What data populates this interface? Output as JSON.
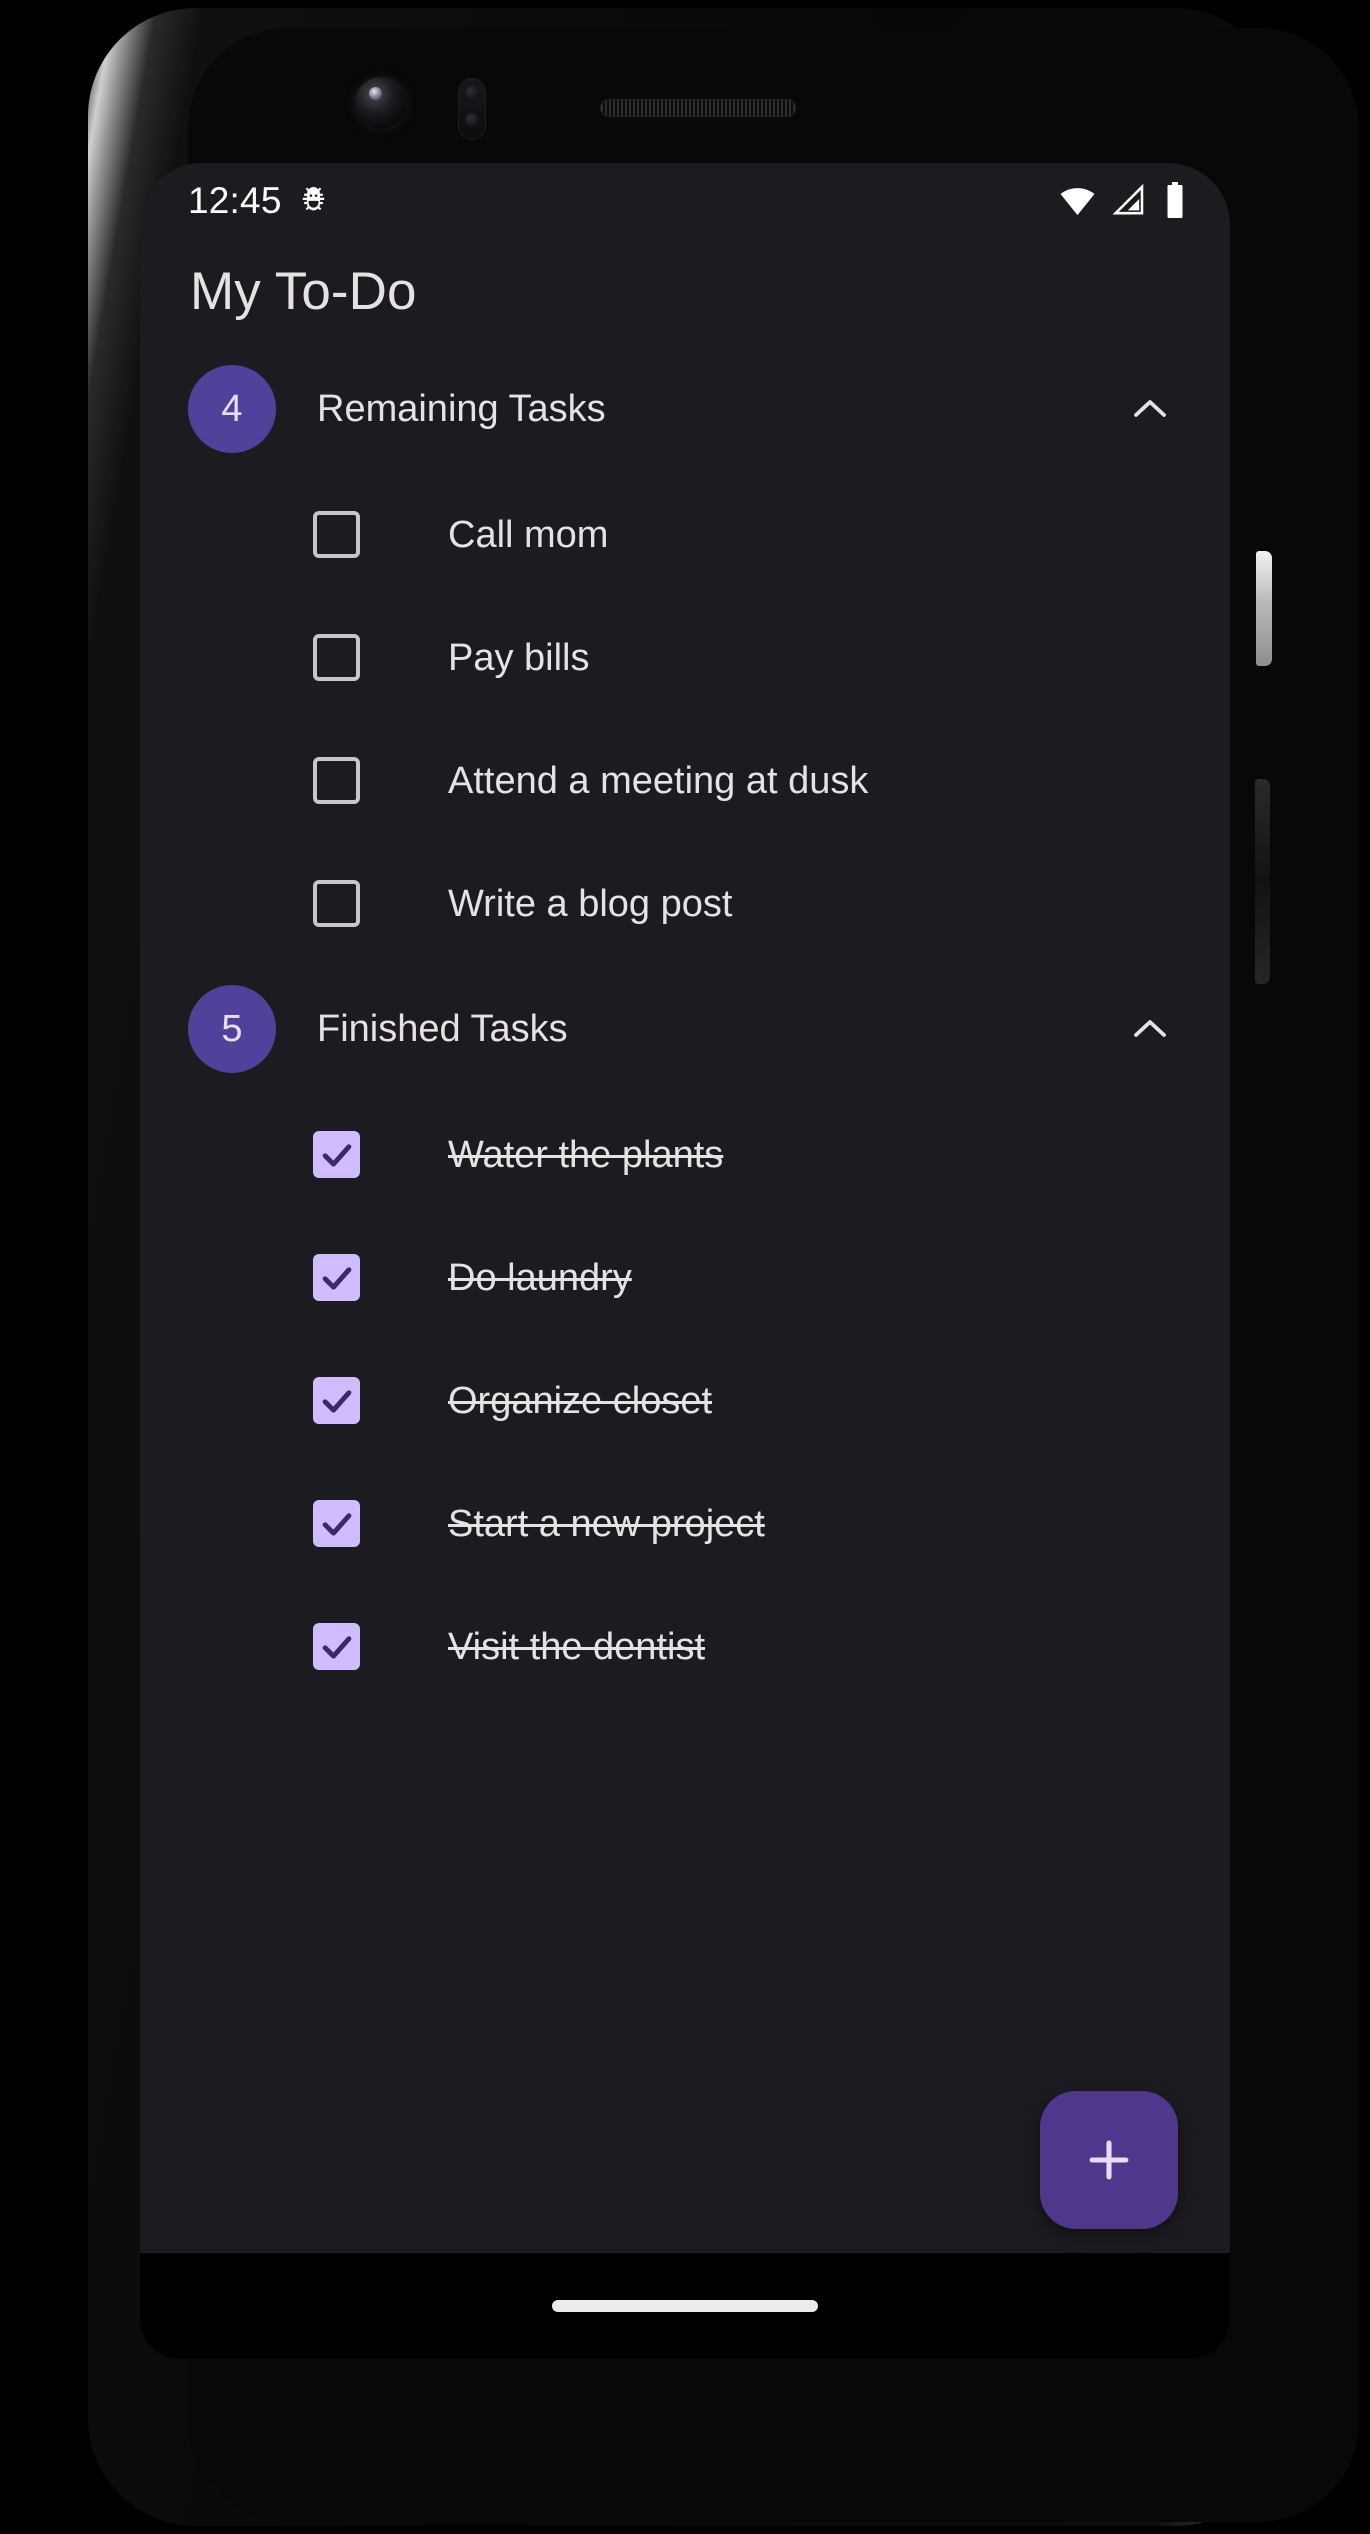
{
  "status_bar": {
    "time": "12:45",
    "icons": [
      "bug-icon",
      "wifi-icon",
      "cellular-signal-icon",
      "battery-icon"
    ]
  },
  "app_bar": {
    "title": "My To-Do"
  },
  "sections": [
    {
      "id": "remaining",
      "count": "4",
      "title": "Remaining Tasks",
      "expanded": true,
      "toggle_icon": "chevron-up-icon",
      "tasks": [
        {
          "label": "Call mom",
          "checked": false
        },
        {
          "label": "Pay bills",
          "checked": false
        },
        {
          "label": "Attend a meeting at dusk",
          "checked": false
        },
        {
          "label": "Write a blog post",
          "checked": false
        }
      ]
    },
    {
      "id": "finished",
      "count": "5",
      "title": "Finished Tasks",
      "expanded": true,
      "toggle_icon": "chevron-up-icon",
      "tasks": [
        {
          "label": "Water the plants",
          "checked": true
        },
        {
          "label": "Do laundry",
          "checked": true
        },
        {
          "label": "Organize closet",
          "checked": true
        },
        {
          "label": "Start a new project",
          "checked": true
        },
        {
          "label": "Visit the dentist",
          "checked": true
        }
      ]
    }
  ],
  "fab": {
    "icon": "plus-icon",
    "label": "+"
  },
  "colors": {
    "screen_bg": "#1c1b1f",
    "accent_purple": "#4f378b",
    "badge_purple": "#52419a",
    "checkbox_checked": "#d0bcff",
    "checkbox_border": "#cac4d0",
    "text_primary": "#e6e1e5",
    "badge_text": "#e8def8",
    "status_icon": "#ffffff",
    "nav_pill": "#ececec"
  }
}
